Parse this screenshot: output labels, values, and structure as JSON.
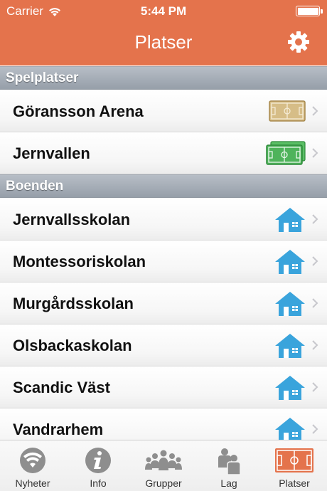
{
  "status_bar": {
    "carrier": "Carrier",
    "time": "5:44 PM"
  },
  "nav": {
    "title": "Platser",
    "settings_icon": "gear-icon"
  },
  "colors": {
    "header": "#e4734c",
    "house": "#3aa4dc",
    "pitch_gold": "#c9a96a",
    "pitch_green": "#3fa94b",
    "tab_active": "#e4734c"
  },
  "sections": [
    {
      "header": "Spelplatser",
      "rows": [
        {
          "label": "Göransson Arena",
          "icon": "field-gold-icon"
        },
        {
          "label": "Jernvallen",
          "icon": "fields-green-icon"
        }
      ]
    },
    {
      "header": "Boenden",
      "rows": [
        {
          "label": "Jernvallsskolan",
          "icon": "house-icon"
        },
        {
          "label": "Montessoriskolan",
          "icon": "house-icon"
        },
        {
          "label": "Murgårdsskolan",
          "icon": "house-icon"
        },
        {
          "label": "Olsbackaskolan",
          "icon": "house-icon"
        },
        {
          "label": "Scandic Väst",
          "icon": "house-icon"
        },
        {
          "label": "Vandrarhem",
          "icon": "house-icon"
        }
      ]
    }
  ],
  "tabs": [
    {
      "label": "Nyheter",
      "icon": "wifi-news-icon",
      "active": false
    },
    {
      "label": "Info",
      "icon": "info-icon",
      "active": false
    },
    {
      "label": "Grupper",
      "icon": "groups-icon",
      "active": false
    },
    {
      "label": "Lag",
      "icon": "team-icon",
      "active": false
    },
    {
      "label": "Platser",
      "icon": "field-icon",
      "active": true
    }
  ]
}
